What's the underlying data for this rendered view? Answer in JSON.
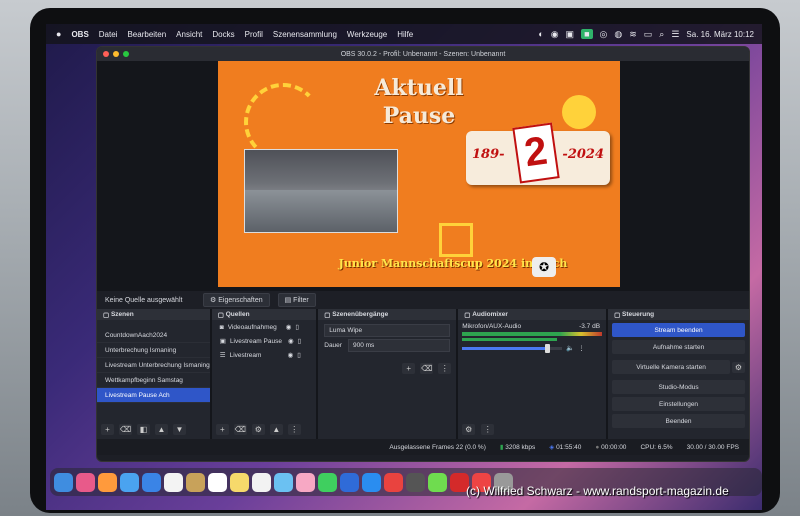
{
  "menubar": {
    "apple": "",
    "items": [
      "OBS",
      "Datei",
      "Bearbeiten",
      "Ansicht",
      "Docks",
      "Profil",
      "Szenensammlung",
      "Werkzeuge",
      "Hilfe"
    ],
    "datetime": "Sa. 16. März  10:12"
  },
  "window": {
    "title": "OBS 30.0.2 - Profil: Unbenannt - Szenen: Unbenannt"
  },
  "preview": {
    "title_line1": "Aktuell",
    "title_line2": "Pause",
    "year_left": "18",
    "year_mid": "9-",
    "big_digit": "2",
    "year_right": "-2024",
    "footer": "Junior Mannschaftscup 2024 in Aach"
  },
  "context": {
    "no_source": "Keine Quelle ausgewählt",
    "properties": "Eigenschaften",
    "filter": "Filter"
  },
  "scenes": {
    "header": "Szenen",
    "items": [
      "CountdownAach2024",
      "Unterbrechung Ismaning",
      "Livestream Unterbrechung Ismaning",
      "Wettkampfbeginn Samstag",
      "Livestream Pause Ach"
    ],
    "selected_index": 4
  },
  "sources": {
    "header": "Quellen",
    "items": [
      "Videoaufnahmeg",
      "Livestream Pause",
      "Livestream"
    ]
  },
  "transitions": {
    "header": "Szenenübergänge",
    "type": "Luma Wipe",
    "duration_label": "Dauer",
    "duration_value": "900 ms"
  },
  "mixer": {
    "header": "Audiomixer",
    "channel": "Mikrofon/AUX-Audio",
    "level": "-3.7 dB",
    "volume_fraction": 0.85
  },
  "controls": {
    "header": "Steuerung",
    "stream": "Stream beenden",
    "record": "Aufnahme starten",
    "vcam": "Virtuelle Kamera starten",
    "studio": "Studio-Modus",
    "settings": "Einstellungen",
    "exit": "Beenden"
  },
  "status": {
    "dropped": "Ausgelassene Frames 22 (0.0 %)",
    "bitrate": "3208 kbps",
    "stream_time": "01:55:40",
    "rec_time": "00:00:00",
    "cpu": "CPU: 6.5%",
    "fps": "30.00 / 30.00 FPS"
  },
  "copyright": "(c) Wilfried Schwarz - www.randsport-magazin.de",
  "colors": {
    "accent": "#2f56c8",
    "preview_bg": "#f07d1f",
    "preview_yellow": "#ffd23a",
    "obs_bg": "#1d1f26"
  }
}
